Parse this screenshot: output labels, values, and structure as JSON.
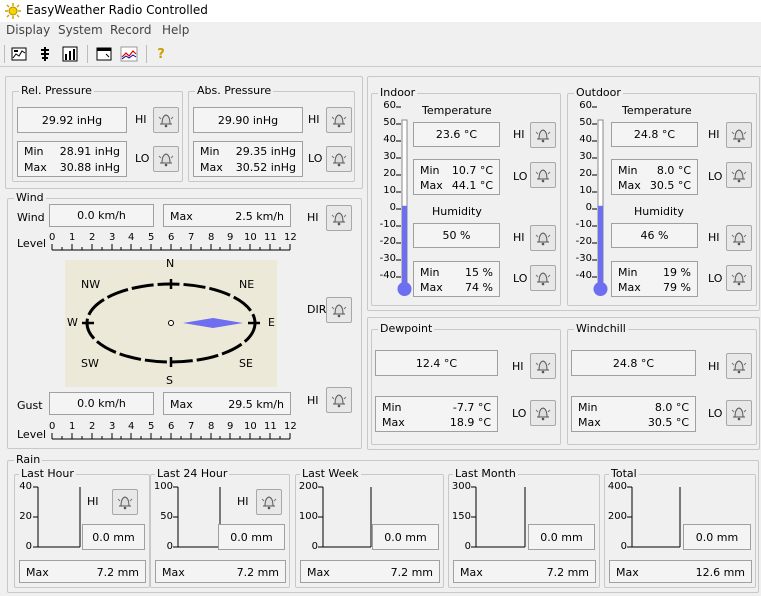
{
  "window": {
    "title": "EasyWeather Radio Controlled"
  },
  "menu": [
    "Display",
    "System",
    "Record",
    "Help"
  ],
  "toolbar": {
    "buttons": [
      "chart-pen-icon",
      "tower-icon",
      "bar-chart-icon",
      "window-icon",
      "line-graph-icon",
      "help-icon"
    ],
    "help_glyph": "?"
  },
  "rel_pressure": {
    "title": "Rel. Pressure",
    "current": "29.92 inHg",
    "min_label": "Min",
    "min": "28.91 inHg",
    "max_label": "Max",
    "max": "30.88 inHg",
    "hi": "HI",
    "lo": "LO"
  },
  "abs_pressure": {
    "title": "Abs. Pressure",
    "current": "29.90 inHg",
    "min_label": "Min",
    "min": "29.35 inHg",
    "max_label": "Max",
    "max": "30.52 inHg",
    "hi": "HI",
    "lo": "LO"
  },
  "wind": {
    "title": "Wind",
    "wind_label": "Wind",
    "speed": "0.0 km/h",
    "max_label": "Max",
    "max": "2.5 km/h",
    "hi": "HI",
    "level_label": "Level",
    "scale": [
      "0",
      "1",
      "2",
      "3",
      "4",
      "5",
      "6",
      "7",
      "8",
      "9",
      "10",
      "11",
      "12"
    ],
    "compass": {
      "n": "N",
      "ne": "NE",
      "e": "E",
      "se": "SE",
      "s": "S",
      "sw": "SW",
      "w": "W",
      "nw": "NW"
    },
    "dir_label": "DIR",
    "gust_label": "Gust",
    "gust": "0.0 km/h",
    "gust_max_label": "Max",
    "gust_max": "29.5 km/h",
    "gust_hi": "HI",
    "gust_level_label": "Level"
  },
  "indoor": {
    "title": "Indoor",
    "thermo_ticks": [
      "60",
      "50",
      "40",
      "30",
      "20",
      "10",
      "0",
      "-10",
      "-20",
      "-30",
      "-40"
    ],
    "thermo_fill": 0.48,
    "temp_title": "Temperature",
    "temp": "23.6 °C",
    "temp_min_label": "Min",
    "temp_min": "10.7 °C",
    "temp_max_label": "Max",
    "temp_max": "44.1 °C",
    "hum_title": "Humidity",
    "hum": "50 %",
    "hum_min_label": "Min",
    "hum_min": "15 %",
    "hum_max_label": "Max",
    "hum_max": "74 %",
    "hi": "HI",
    "lo": "LO",
    "hum_hi": "HI",
    "hum_lo": "LO"
  },
  "outdoor": {
    "title": "Outdoor",
    "thermo_ticks": [
      "60",
      "50",
      "40",
      "30",
      "20",
      "10",
      "0",
      "-10",
      "-20",
      "-30",
      "-40"
    ],
    "thermo_fill": 0.48,
    "temp_title": "Temperature",
    "temp": "24.8 °C",
    "temp_min_label": "Min",
    "temp_min": "8.0 °C",
    "temp_max_label": "Max",
    "temp_max": "30.5 °C",
    "hum_title": "Humidity",
    "hum": "46 %",
    "hum_min_label": "Min",
    "hum_min": "19 %",
    "hum_max_label": "Max",
    "hum_max": "79 %",
    "hi": "HI",
    "lo": "LO",
    "hum_hi": "HI",
    "hum_lo": "LO"
  },
  "dewpoint": {
    "title": "Dewpoint",
    "current": "12.4 °C",
    "min_label": "Min",
    "min": "-7.7 °C",
    "max_label": "Max",
    "max": "18.9 °C",
    "hi": "HI",
    "lo": "LO"
  },
  "windchill": {
    "title": "Windchill",
    "current": "24.8 °C",
    "min_label": "Min",
    "min": "8.0 °C",
    "max_label": "Max",
    "max": "30.5 °C",
    "hi": "HI",
    "lo": "LO"
  },
  "rain": {
    "title": "Rain",
    "panels": [
      {
        "title": "Last Hour",
        "axis": [
          "40",
          "20",
          "0"
        ],
        "hi": "HI",
        "value": "0.0 mm",
        "max_label": "Max",
        "max": "7.2 mm"
      },
      {
        "title": "Last 24 Hour",
        "axis": [
          "100",
          "50",
          "0"
        ],
        "hi": "HI",
        "value": "0.0 mm",
        "max_label": "Max",
        "max": "7.2 mm"
      },
      {
        "title": "Last Week",
        "axis": [
          "200",
          "100",
          "0"
        ],
        "value": "0.0 mm",
        "max_label": "Max",
        "max": "7.2 mm"
      },
      {
        "title": "Last Month",
        "axis": [
          "300",
          "150",
          "0"
        ],
        "value": "0.0 mm",
        "max_label": "Max",
        "max": "7.2 mm"
      },
      {
        "title": "Total",
        "axis": [
          "400",
          "200",
          "0"
        ],
        "value": "0.0 mm",
        "max_label": "Max",
        "max": "12.6 mm"
      }
    ]
  },
  "colors": {
    "accent": "#6e6ef0",
    "compass_bg": "#ece9d8"
  }
}
